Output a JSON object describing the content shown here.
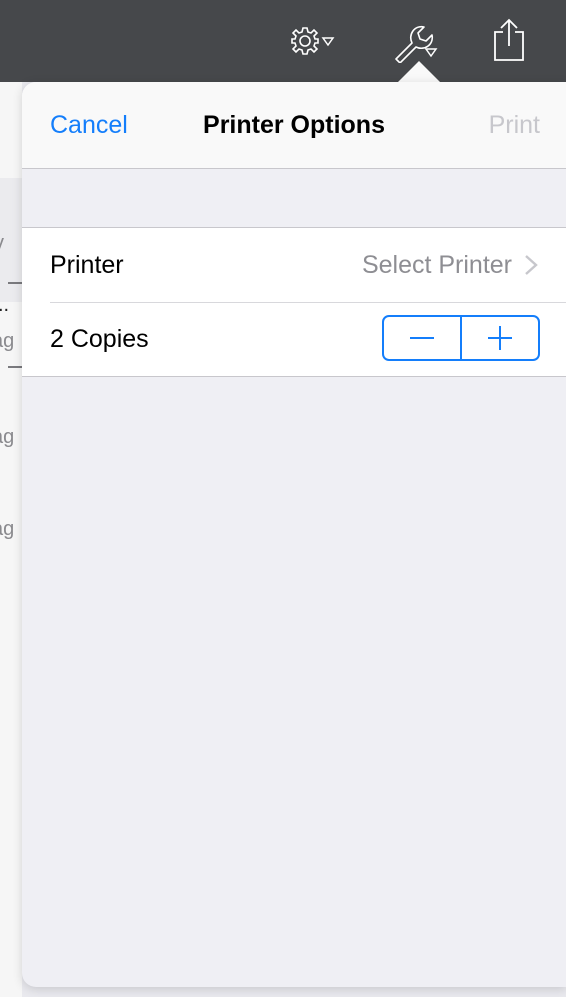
{
  "toolbar": {
    "icons": [
      "gear-with-dropdown-icon",
      "wrench-with-dropdown-icon",
      "share-icon"
    ]
  },
  "background": {
    "fragments": [
      "v",
      "..",
      "ag",
      "ag",
      "ag"
    ]
  },
  "popover": {
    "nav": {
      "cancel_label": "Cancel",
      "title": "Printer Options",
      "print_label": "Print"
    },
    "rows": {
      "printer_label": "Printer",
      "printer_value": "Select Printer",
      "copies_label": "2 Copies"
    }
  },
  "colors": {
    "accent": "#147efb",
    "toolbar": "#46484b",
    "disabled": "#c7c7cc",
    "secondary_text": "#8e8e93",
    "grouped_background": "#efeff4"
  }
}
